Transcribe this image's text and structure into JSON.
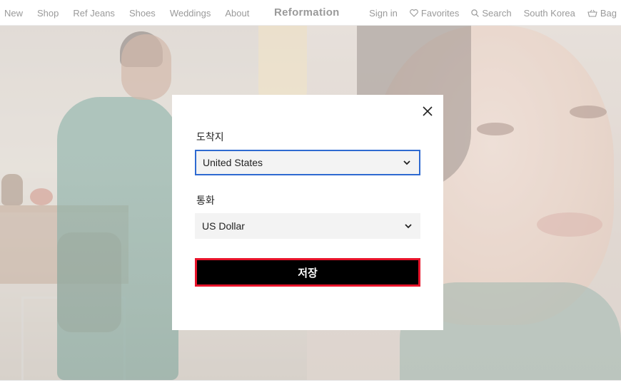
{
  "header": {
    "nav_left": [
      "New",
      "Shop",
      "Ref Jeans",
      "Shoes",
      "Weddings",
      "About"
    ],
    "logo": "Reformation",
    "sign_in": "Sign in",
    "favorites": "Favorites",
    "search": "Search",
    "region": "South Korea",
    "bag": "Bag"
  },
  "modal": {
    "destination_label": "도착지",
    "destination_value": "United States",
    "currency_label": "통화",
    "currency_value": "US Dollar",
    "save_label": "저장",
    "accent_color": "#2e6ad1",
    "highlight_color": "#e8142b"
  }
}
